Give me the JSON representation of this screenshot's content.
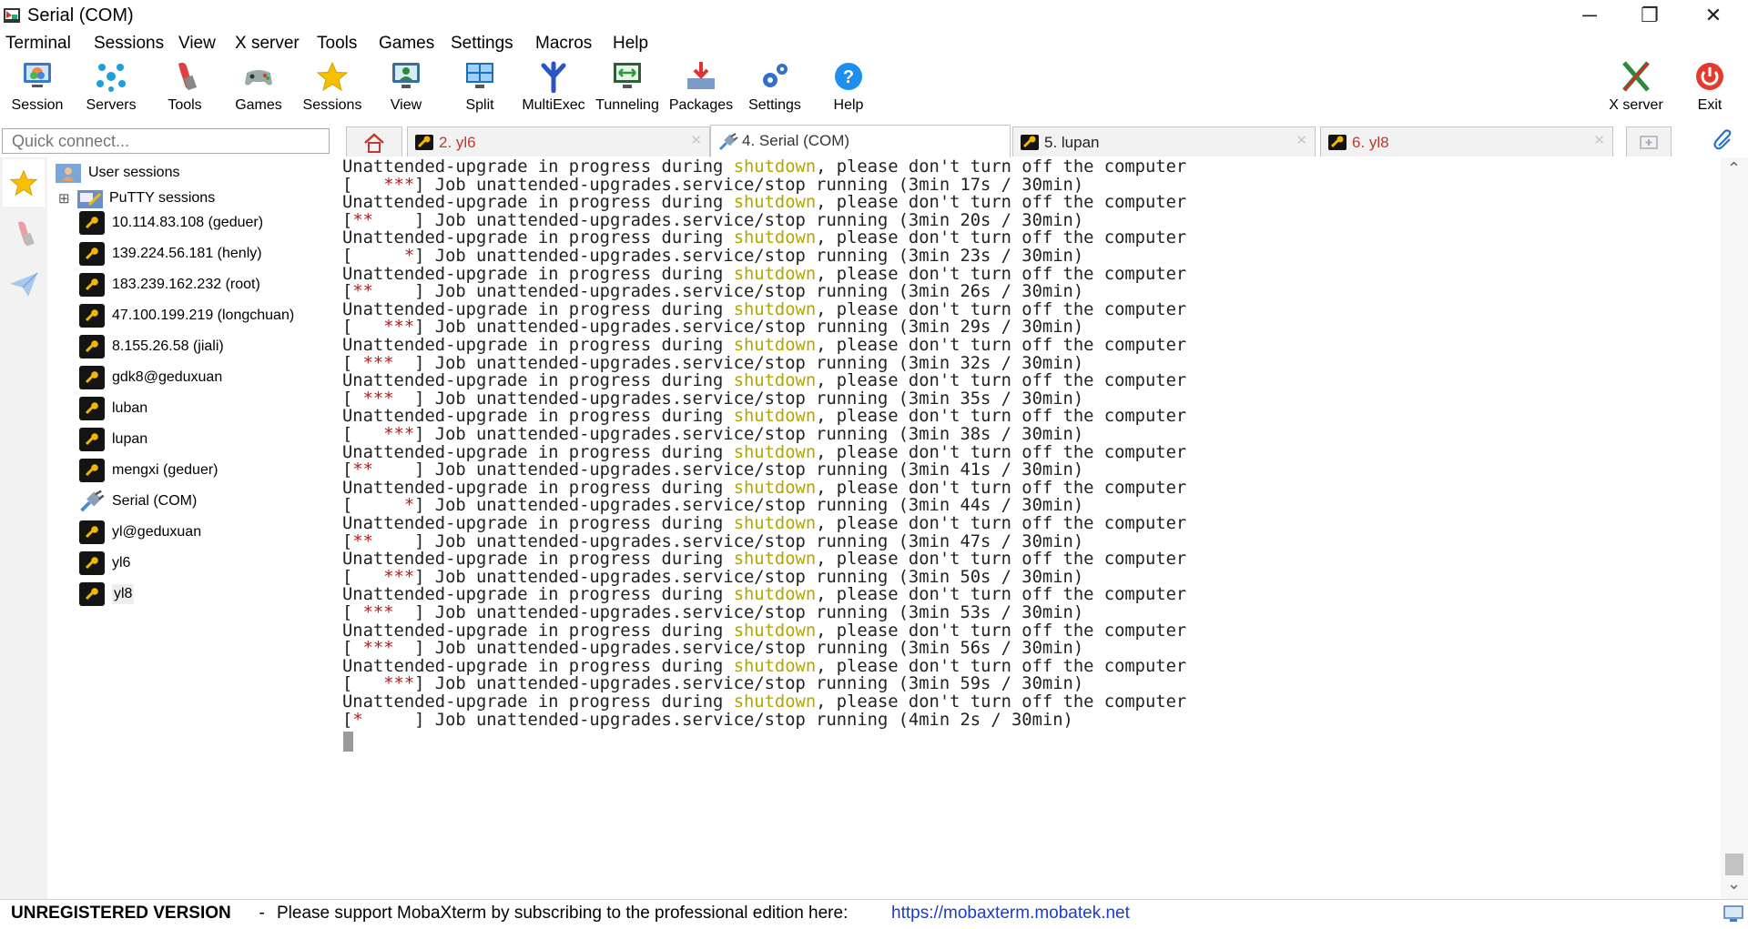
{
  "window": {
    "title": "Serial (COM)",
    "minimize": "─",
    "restore": "❐",
    "close": "✕"
  },
  "menu": [
    "Terminal",
    "Sessions",
    "View",
    "X server",
    "Tools",
    "Games",
    "Settings",
    "Macros",
    "Help"
  ],
  "toolbar": [
    {
      "label": "Session",
      "icon": "session-icon"
    },
    {
      "label": "Servers",
      "icon": "servers-icon"
    },
    {
      "label": "Tools",
      "icon": "tools-icon"
    },
    {
      "label": "Games",
      "icon": "games-icon"
    },
    {
      "label": "Sessions",
      "icon": "star-icon"
    },
    {
      "label": "View",
      "icon": "view-icon"
    },
    {
      "label": "Split",
      "icon": "split-icon"
    },
    {
      "label": "MultiExec",
      "icon": "multiexec-icon"
    },
    {
      "label": "Tunneling",
      "icon": "tunneling-icon"
    },
    {
      "label": "Packages",
      "icon": "packages-icon"
    },
    {
      "label": "Settings",
      "icon": "settings-icon"
    },
    {
      "label": "Help",
      "icon": "help-icon"
    }
  ],
  "toolbar_right": [
    {
      "label": "X server",
      "icon": "x-server-icon"
    },
    {
      "label": "Exit",
      "icon": "power-icon"
    }
  ],
  "quick_connect": {
    "placeholder": "Quick connect..."
  },
  "tabs": [
    {
      "label": "2. yl6",
      "color": "#c0392b",
      "active": false
    },
    {
      "label": "4. Serial (COM)",
      "color": "#333333",
      "active": true
    },
    {
      "label": "5. lupan",
      "color": "#222222",
      "active": false
    },
    {
      "label": "6. yl8",
      "color": "#c0392b",
      "active": false
    }
  ],
  "sidebar": {
    "root": "User sessions",
    "folder": "PuTTY sessions",
    "expander": "⊞",
    "items": [
      {
        "label": "10.114.83.108 (geduer)",
        "type": "ssh"
      },
      {
        "label": "139.224.56.181 (henly)",
        "type": "ssh"
      },
      {
        "label": "183.239.162.232 (root)",
        "type": "ssh"
      },
      {
        "label": "47.100.199.219 (longchuan)",
        "type": "ssh"
      },
      {
        "label": "8.155.26.58 (jiali)",
        "type": "ssh"
      },
      {
        "label": "gdk8@geduxuan",
        "type": "ssh"
      },
      {
        "label": "luban",
        "type": "ssh"
      },
      {
        "label": "lupan",
        "type": "ssh"
      },
      {
        "label": "mengxi (geduer)",
        "type": "ssh"
      },
      {
        "label": "Serial (COM)",
        "type": "serial"
      },
      {
        "label": "yl@geduxuan",
        "type": "ssh"
      },
      {
        "label": "yl6",
        "type": "ssh"
      },
      {
        "label": "yl8",
        "type": "ssh"
      }
    ]
  },
  "terminal": {
    "warn_pre": "Unattended-upgrade in progress during ",
    "warn_word": "shutdown",
    "warn_post": ", please don't turn off the computer",
    "job_text": "] Job unattended-upgrades.service/stop running (",
    "job_limit": " / 30min)",
    "jobs": [
      {
        "stars": "   ***",
        "elapsed": "3min 17s"
      },
      {
        "stars": "**    ",
        "elapsed": "3min 20s"
      },
      {
        "stars": "     *",
        "elapsed": "3min 23s"
      },
      {
        "stars": "**    ",
        "elapsed": "3min 26s"
      },
      {
        "stars": "   ***",
        "elapsed": "3min 29s"
      },
      {
        "stars": " ***  ",
        "elapsed": "3min 32s"
      },
      {
        "stars": " ***  ",
        "elapsed": "3min 35s"
      },
      {
        "stars": "   ***",
        "elapsed": "3min 38s"
      },
      {
        "stars": "**    ",
        "elapsed": "3min 41s"
      },
      {
        "stars": "     *",
        "elapsed": "3min 44s"
      },
      {
        "stars": "**    ",
        "elapsed": "3min 47s"
      },
      {
        "stars": "   ***",
        "elapsed": "3min 50s"
      },
      {
        "stars": " ***  ",
        "elapsed": "3min 53s"
      },
      {
        "stars": " ***  ",
        "elapsed": "3min 56s"
      },
      {
        "stars": "   ***",
        "elapsed": "3min 59s"
      },
      {
        "stars": "*     ",
        "elapsed": "4min 2s"
      }
    ]
  },
  "scroll": {
    "up": "⌃",
    "down": "⌄"
  },
  "status": {
    "unregistered": "UNREGISTERED VERSION",
    "dash": "  -  ",
    "message": "Please support MobaXterm by subscribing to the professional edition here:",
    "link": "https://mobaxterm.mobatek.net"
  }
}
